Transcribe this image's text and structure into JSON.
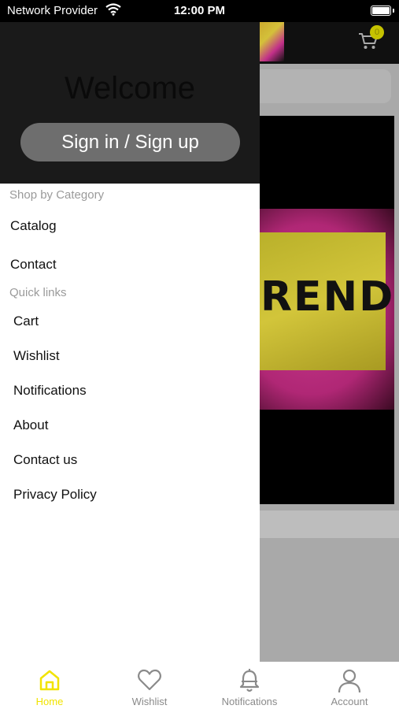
{
  "status_bar": {
    "carrier": "Network Provider",
    "time": "12:00 PM"
  },
  "header": {
    "cart_badge": "0"
  },
  "banner": {
    "text": "RENDZ"
  },
  "drawer": {
    "welcome": "Welcome",
    "signin_label": "Sign in / Sign up",
    "shop_section_title": "Shop by Category",
    "shop_items": [
      {
        "label": "Catalog"
      },
      {
        "label": "Contact"
      }
    ],
    "quick_section_title": "Quick links",
    "quick_items": [
      {
        "label": "Cart"
      },
      {
        "label": "Wishlist"
      },
      {
        "label": "Notifications"
      },
      {
        "label": "About"
      },
      {
        "label": "Contact us"
      },
      {
        "label": "Privacy Policy"
      }
    ]
  },
  "tabs": [
    {
      "label": "Home",
      "icon": "home-icon",
      "active": true
    },
    {
      "label": "Wishlist",
      "icon": "heart-icon",
      "active": false
    },
    {
      "label": "Notifications",
      "icon": "bell-icon",
      "active": false
    },
    {
      "label": "Account",
      "icon": "person-icon",
      "active": false
    }
  ],
  "colors": {
    "accent": "#f1e300",
    "drawer_header": "#1a1a1a",
    "signin_button": "#6e6e6e",
    "badge": "#c5c200"
  }
}
